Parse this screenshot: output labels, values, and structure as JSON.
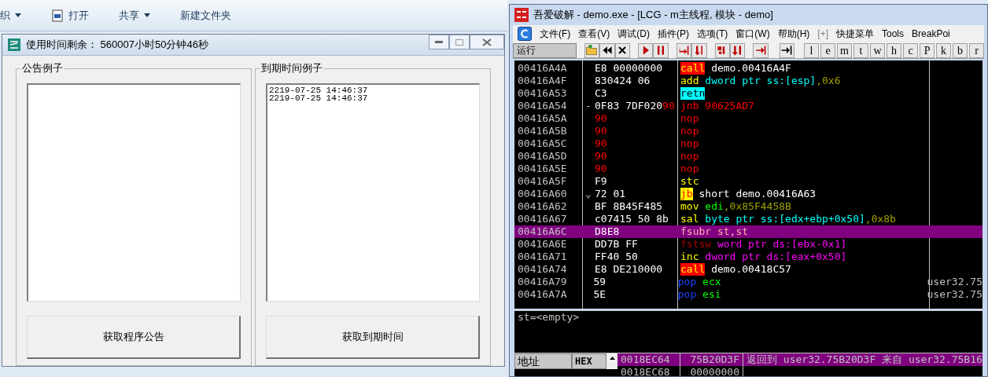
{
  "explorer_toolbar": {
    "items": [
      {
        "label": "织",
        "kind": "dropdown"
      },
      {
        "label": "打开",
        "kind": "icon"
      },
      {
        "label": "共享",
        "kind": "dropdown"
      },
      {
        "label": "新建文件夹",
        "kind": "plain"
      }
    ]
  },
  "dialog": {
    "title": "使用时间剩余： 560007小时50分钟46秒",
    "groups": [
      {
        "title": "公告例子",
        "button": "获取程序公告"
      },
      {
        "title": "到期时间例子",
        "lines": [
          "2219-07-25 14:46:37",
          "2219-07-25 14:46:37"
        ],
        "button": "获取到期时间"
      }
    ]
  },
  "debugger": {
    "title": "吾爱破解 - demo.exe - [LCG - m主线程, 模块 - demo]",
    "menu": [
      "文件(F)",
      "查看(V)",
      "调试(D)",
      "插件(P)",
      "选项(T)",
      "窗口(W)",
      "帮助(H)",
      "[+]",
      "快捷菜单",
      "Tools",
      "BreakPoi"
    ],
    "status": "运行",
    "toolbar_letters": [
      "l",
      "e",
      "m",
      "t",
      "w",
      "h",
      "c",
      "P",
      "k",
      "b",
      "r"
    ],
    "disassembly": {
      "rows": [
        {
          "address": "00416A4A",
          "hex": [
            {
              "text": "E8 00000000",
              "kind": "byte"
            }
          ],
          "code": [
            {
              "text": "call",
              "kind": "call"
            },
            {
              "text": " demo.00416A4F",
              "kind": "plain"
            }
          ],
          "selected": false
        },
        {
          "address": "00416A4F",
          "hex": [
            {
              "text": "830424 06",
              "kind": "byte"
            }
          ],
          "code": [
            {
              "text": "add",
              "kind": "mnemonic"
            },
            {
              "text": " dword ptr ss:[esp]",
              "kind": "memory"
            },
            {
              "text": ",0x6",
              "kind": "constant"
            }
          ],
          "selected": false
        },
        {
          "address": "00416A53",
          "hex": [
            {
              "text": "C3",
              "kind": "byte"
            }
          ],
          "code": [
            {
              "text": "retn",
              "kind": "return"
            }
          ],
          "selected": false
        },
        {
          "address": "00416A54",
          "mark": "-",
          "hex": [
            {
              "text": "0F83 7DF020",
              "kind": "byte"
            },
            {
              "text": "90",
              "kind": "patched"
            }
          ],
          "code": [
            {
              "text": "jnb 90625AD7",
              "kind": "invalid"
            }
          ],
          "selected": false
        },
        {
          "address": "00416A5A",
          "hex": [
            {
              "text": "90",
              "kind": "patched"
            }
          ],
          "code": [
            {
              "text": "nop",
              "kind": "invalid"
            }
          ],
          "selected": false
        },
        {
          "address": "00416A5B",
          "hex": [
            {
              "text": "90",
              "kind": "patched"
            }
          ],
          "code": [
            {
              "text": "nop",
              "kind": "invalid"
            }
          ],
          "selected": false
        },
        {
          "address": "00416A5C",
          "hex": [
            {
              "text": "90",
              "kind": "patched"
            }
          ],
          "code": [
            {
              "text": "nop",
              "kind": "invalid"
            }
          ],
          "selected": false
        },
        {
          "address": "00416A5D",
          "hex": [
            {
              "text": "90",
              "kind": "patched"
            }
          ],
          "code": [
            {
              "text": "nop",
              "kind": "invalid"
            }
          ],
          "selected": false
        },
        {
          "address": "00416A5E",
          "hex": [
            {
              "text": "90",
              "kind": "patched"
            }
          ],
          "code": [
            {
              "text": "nop",
              "kind": "invalid"
            }
          ],
          "selected": false
        },
        {
          "address": "00416A5F",
          "hex": [
            {
              "text": "F9",
              "kind": "byte"
            }
          ],
          "code": [
            {
              "text": "stc",
              "kind": "mnemonic"
            }
          ],
          "selected": false
        },
        {
          "address": "00416A60",
          "mark": "⌄",
          "hex": [
            {
              "text": "72 01",
              "kind": "byte"
            }
          ],
          "code": [
            {
              "text": "jb",
              "kind": "jump"
            },
            {
              "text": " short demo.00416A63",
              "kind": "plain"
            }
          ],
          "selected": false
        },
        {
          "address": "00416A62",
          "hex": [
            {
              "text": "BF 8B45F485",
              "kind": "byte"
            }
          ],
          "code": [
            {
              "text": "mov",
              "kind": "mnemonic"
            },
            {
              "text": " edi",
              "kind": "register"
            },
            {
              "text": ",0x85F4458B",
              "kind": "constant"
            }
          ],
          "selected": false
        },
        {
          "address": "00416A67",
          "hex": [
            {
              "text": "c07415 50 8b",
              "kind": "byte"
            }
          ],
          "code": [
            {
              "text": "sal",
              "kind": "mnemonic"
            },
            {
              "text": " byte ptr ss:[edx+ebp+0x50]",
              "kind": "memory"
            },
            {
              "text": ",0x8b",
              "kind": "constant"
            }
          ],
          "selected": false
        },
        {
          "address": "00416A6C",
          "hex": [
            {
              "text": "D8E8",
              "kind": "byte"
            }
          ],
          "code": [
            {
              "text": "fsubr st,st",
              "kind": "fpu"
            }
          ],
          "selected": true
        },
        {
          "address": "00416A6E",
          "hex": [
            {
              "text": "DD7B FF",
              "kind": "byte"
            }
          ],
          "code": [
            {
              "text": "fstsw",
              "kind": "fpu"
            },
            {
              "text": " word ptr ds:[ebx-0x1]",
              "kind": "pointer"
            }
          ],
          "selected": false
        },
        {
          "address": "00416A71",
          "hex": [
            {
              "text": "FF40 50",
              "kind": "byte"
            }
          ],
          "code": [
            {
              "text": "inc",
              "kind": "mnemonic"
            },
            {
              "text": " dword ptr ds:[eax+0x50]",
              "kind": "pointer"
            }
          ],
          "selected": false
        },
        {
          "address": "00416A74",
          "hex": [
            {
              "text": "E8 DE210000",
              "kind": "byte"
            }
          ],
          "code": [
            {
              "text": "call",
              "kind": "call"
            },
            {
              "text": " demo.00418C57",
              "kind": "plain"
            }
          ],
          "selected": false
        },
        {
          "address": "00416A79",
          "hex": [
            {
              "text": "59",
              "kind": "byte"
            }
          ],
          "code": [
            {
              "text": "pop",
              "kind": "stack"
            },
            {
              "text": " ecx",
              "kind": "register"
            }
          ],
          "comment": "user32.75",
          "selected": false
        },
        {
          "address": "00416A7A",
          "hex": [
            {
              "text": "5E",
              "kind": "byte"
            }
          ],
          "code": [
            {
              "text": "pop",
              "kind": "stack"
            },
            {
              "text": " esi",
              "kind": "register"
            }
          ],
          "comment": "user32.75",
          "selected": false
        }
      ]
    },
    "info": "st=<empty>",
    "dump": {
      "columns": [
        "地址",
        "HEX"
      ]
    },
    "stack": {
      "rows": [
        {
          "address": "0018EC64",
          "value": "75B20D3F",
          "comment": "返回到 user32.75B20D3F 来自 user32.75B16",
          "selected": true
        },
        {
          "address": "0018EC68",
          "value": "00000000",
          "selected": false
        }
      ]
    }
  }
}
